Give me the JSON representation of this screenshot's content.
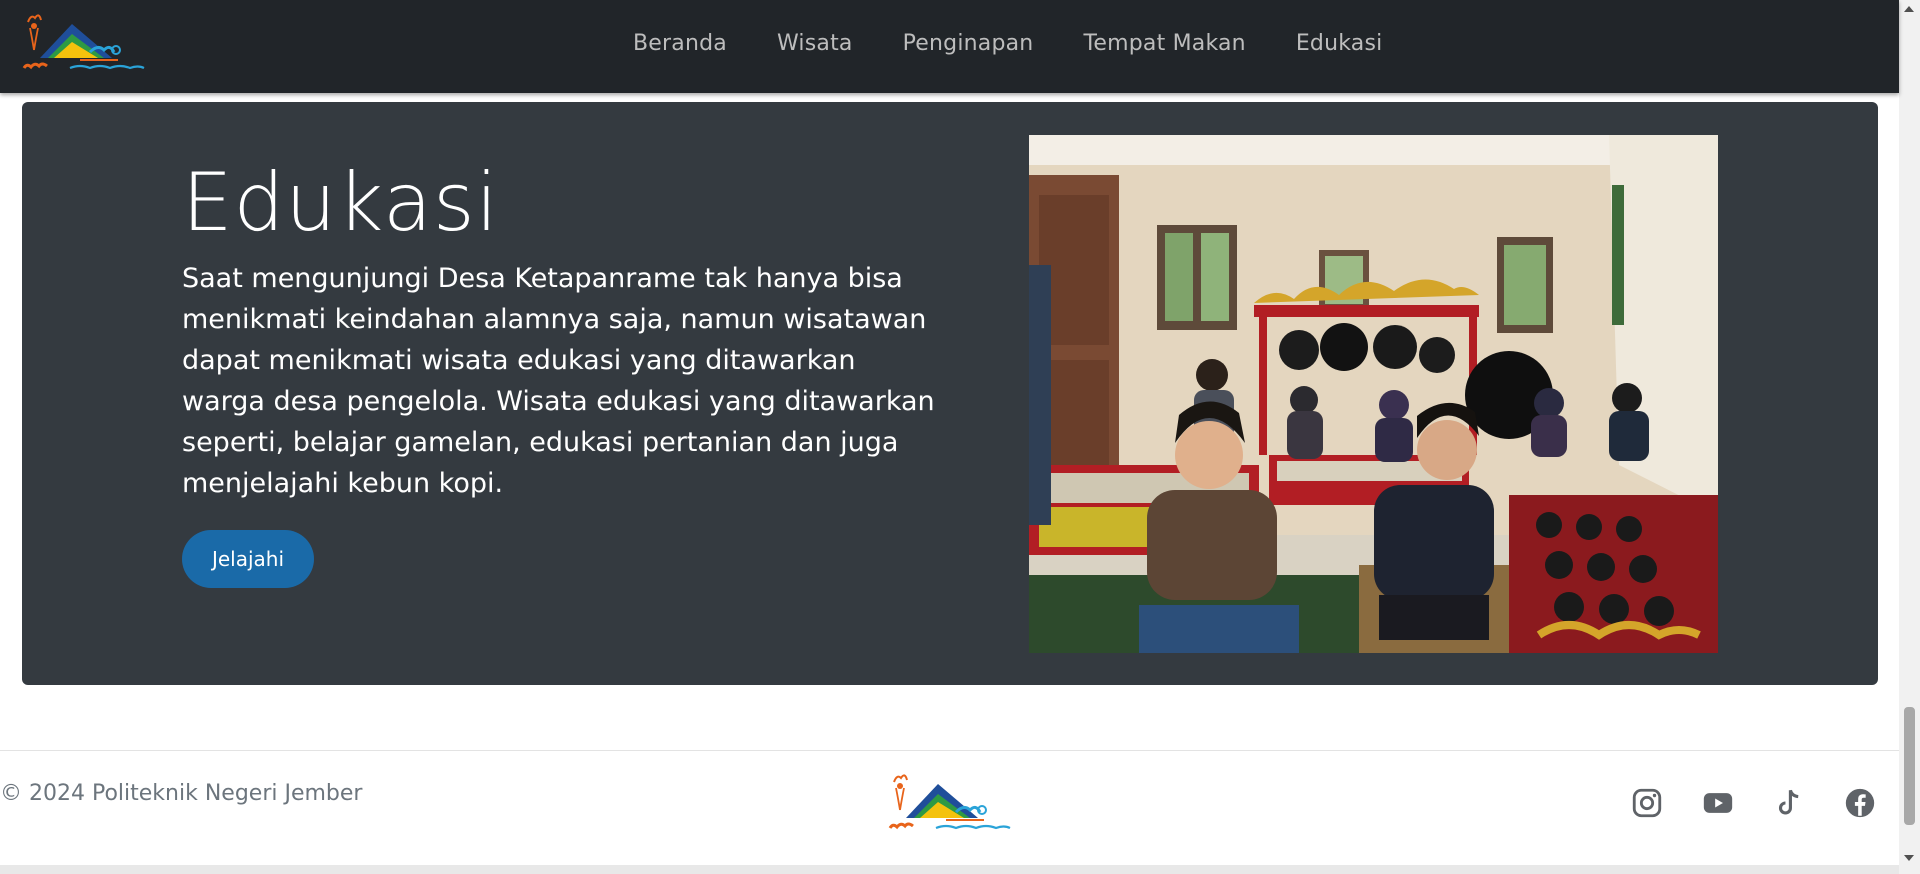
{
  "nav": {
    "brand_logo": "saba ketapanrame",
    "links": [
      {
        "label": "Beranda"
      },
      {
        "label": "Wisata"
      },
      {
        "label": "Penginapan"
      },
      {
        "label": "Tempat Makan"
      },
      {
        "label": "Edukasi"
      }
    ]
  },
  "hero": {
    "title": "Edukasi",
    "description": "Saat mengunjungi Desa Ketapanrame tak hanya bisa menikmati keindahan alamnya saja, namun wisatawan dapat menikmati wisata edukasi yang ditawarkan warga desa pengelola. Wisata edukasi yang ditawarkan seperti, belajar gamelan, edukasi pertanian dan juga menjelajahi kebun kopi.",
    "button_label": "Jelajahi",
    "image_alt": "Gamelan class photo"
  },
  "footer": {
    "copyright": "© 2024 Politeknik Negeri Jember",
    "logo": "saba ketapanrame",
    "socials": [
      {
        "icon": "instagram-icon"
      },
      {
        "icon": "youtube-icon"
      },
      {
        "icon": "tiktok-icon"
      },
      {
        "icon": "facebook-icon"
      }
    ]
  },
  "colors": {
    "navbar_bg": "#212529",
    "hero_bg": "#343a40",
    "button_bg": "#1a6aa8",
    "nav_link": "#bdbdbd",
    "footer_text": "#6c757d",
    "social_icon": "#5f6368"
  }
}
